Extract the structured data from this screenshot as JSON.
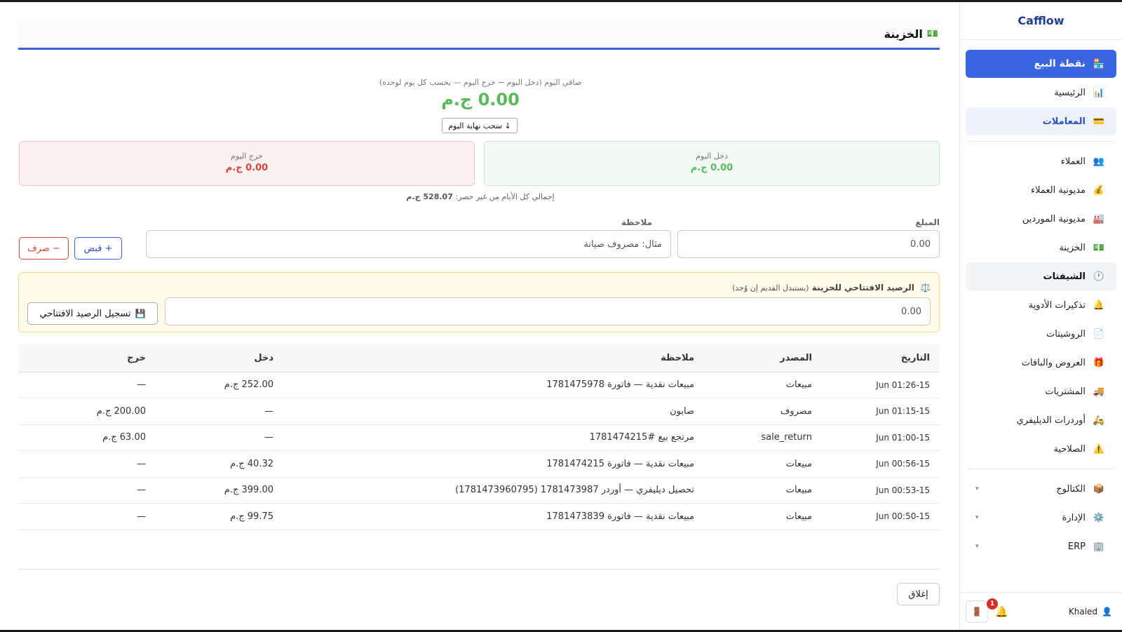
{
  "app": {
    "brand": "Cafflow"
  },
  "sidebar": {
    "items": [
      {
        "icon": "🏪",
        "label": "نقطة البيع"
      },
      {
        "icon": "📊",
        "label": "الرئيسية"
      },
      {
        "icon": "💳",
        "label": "المعاملات"
      },
      {
        "icon": "👥",
        "label": "العملاء"
      },
      {
        "icon": "💰",
        "label": "مديونية العملاء"
      },
      {
        "icon": "🏭",
        "label": "مديونية الموردين"
      },
      {
        "icon": "💵",
        "label": "الخزينة"
      },
      {
        "icon": "🕐",
        "label": "الشيفتات"
      },
      {
        "icon": "🔔",
        "label": "تذكيرات الأدوية"
      },
      {
        "icon": "📄",
        "label": "الروشيتات"
      },
      {
        "icon": "🎁",
        "label": "العروض والباقات"
      },
      {
        "icon": "🚚",
        "label": "المشتريات"
      },
      {
        "icon": "🛵",
        "label": "أوردرات الديليفري"
      },
      {
        "icon": "⚠️",
        "label": "الصلاحية"
      }
    ],
    "groups": [
      {
        "icon": "📦",
        "label": "الكتالوج",
        "chevron": "▾"
      },
      {
        "icon": "⚙️",
        "label": "الإدارة",
        "chevron": "▾"
      },
      {
        "icon": "🏢",
        "label": "ERP",
        "chevron": "▾"
      }
    ],
    "footer": {
      "user_icon": "👤",
      "user": "Khaled",
      "bell_icon": "🔔",
      "notifications": "1",
      "logout_icon": "🚪"
    }
  },
  "page": {
    "icon": "💵",
    "title": "الخزينة",
    "net_label": "صافي اليوم (دخل اليوم − خرج اليوم — يحسب كل يوم لوحده)",
    "net_value": "0.00 ج.م",
    "withdraw_button": "↓ سحب نهاية اليوم",
    "income_card": {
      "label": "دخل اليوم",
      "value": "0.00 ج.م"
    },
    "expense_card": {
      "label": "خرج اليوم",
      "value": "0.00 ج.م"
    },
    "total_label": "إجمالي كل الأيام من غير حصر:",
    "total_value": "528.07 ج.م",
    "amount_label": "المبلغ",
    "amount_placeholder": "0.00",
    "note_label": "ملاحظة",
    "note_placeholder": "مثال: مصروف صيانة",
    "receive_button": "+ قبض",
    "spend_button": "− صرف",
    "opening": {
      "icon": "⚖️",
      "title": "الرصيد الافتتاحي للخزينة",
      "subtitle": "(يستبدل القديم إن وُجد)",
      "placeholder": "0.00",
      "button_icon": "💾",
      "button": "تسجيل الرصيد الافتتاحي"
    },
    "table": {
      "headers": {
        "date": "التاريخ",
        "source": "المصدر",
        "note": "ملاحظة",
        "income": "دخل",
        "expense": "خرج"
      },
      "rows": [
        {
          "date": "15-Jun 01:26",
          "source": "مبيعات",
          "note": "مبيعات نقدية — فاتورة 1781475978",
          "income": "252.00 ج.م",
          "expense": "—"
        },
        {
          "date": "15-Jun 01:15",
          "source": "مصروف",
          "note": "صابون",
          "income": "—",
          "expense": "200.00 ج.م"
        },
        {
          "date": "15-Jun 01:00",
          "source": "sale_return",
          "note": "مرتجع بيع #1781474215",
          "income": "—",
          "expense": "63.00 ج.م"
        },
        {
          "date": "15-Jun 00:56",
          "source": "مبيعات",
          "note": "مبيعات نقدية — فاتورة 1781474215",
          "income": "40.32 ج.م",
          "expense": "—"
        },
        {
          "date": "15-Jun 00:53",
          "source": "مبيعات",
          "note": "تحصيل ديليفري — أوردر 1781473987 (1781473960795)",
          "income": "399.00 ج.م",
          "expense": "—"
        },
        {
          "date": "15-Jun 00:50",
          "source": "مبيعات",
          "note": "مبيعات نقدية — فاتورة 1781473839",
          "income": "99.75 ج.م",
          "expense": "—"
        }
      ]
    },
    "close_button": "إغلاق"
  }
}
